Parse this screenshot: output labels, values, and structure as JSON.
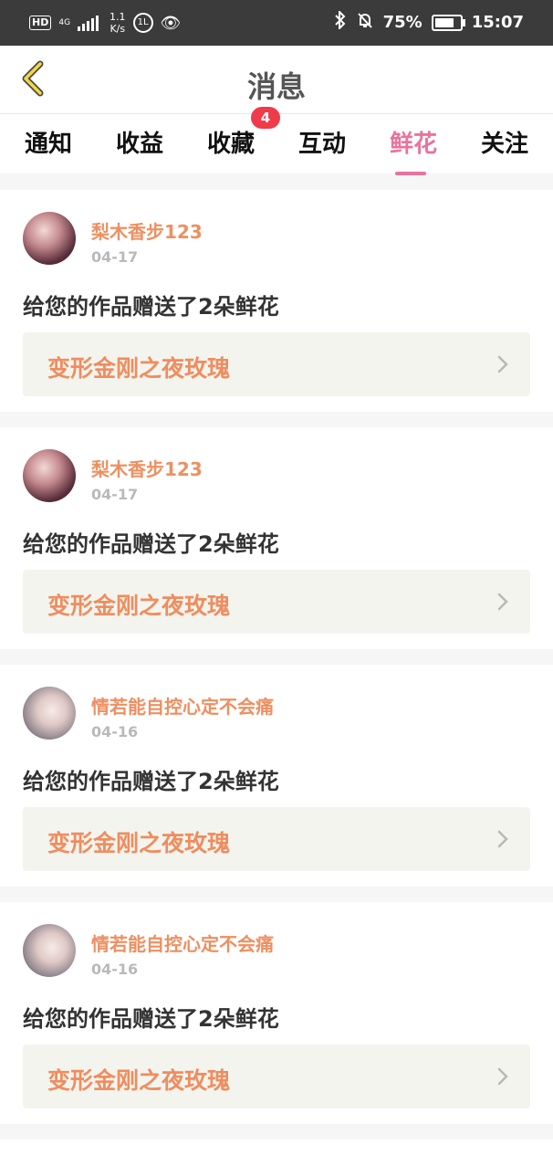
{
  "status_bar": {
    "hd": "HD",
    "net": "4G",
    "speed_top": "1.1",
    "speed_bottom": "K/s",
    "badge_icon_text": "1L",
    "battery_percent": "75%",
    "time": "15:07"
  },
  "header": {
    "title": "消息"
  },
  "tabs": [
    {
      "label": "通知"
    },
    {
      "label": "收益"
    },
    {
      "label": "收藏",
      "badge": "4"
    },
    {
      "label": "互动"
    },
    {
      "label": "鲜花",
      "active": true
    },
    {
      "label": "关注"
    }
  ],
  "colors": {
    "accent": "#e9739e",
    "username": "#ee8f61",
    "badge": "#ef3b4a"
  },
  "notifications": [
    {
      "username": "梨木香步123",
      "date": "04-17",
      "message": "给您的作品赠送了2朵鲜花",
      "work_title": "变形金刚之夜玫瑰"
    },
    {
      "username": "梨木香步123",
      "date": "04-17",
      "message": "给您的作品赠送了2朵鲜花",
      "work_title": "变形金刚之夜玫瑰"
    },
    {
      "username": "情若能自控心定不会痛",
      "date": "04-16",
      "message": "给您的作品赠送了2朵鲜花",
      "work_title": "变形金刚之夜玫瑰"
    },
    {
      "username": "情若能自控心定不会痛",
      "date": "04-16",
      "message": "给您的作品赠送了2朵鲜花",
      "work_title": "变形金刚之夜玫瑰"
    }
  ]
}
